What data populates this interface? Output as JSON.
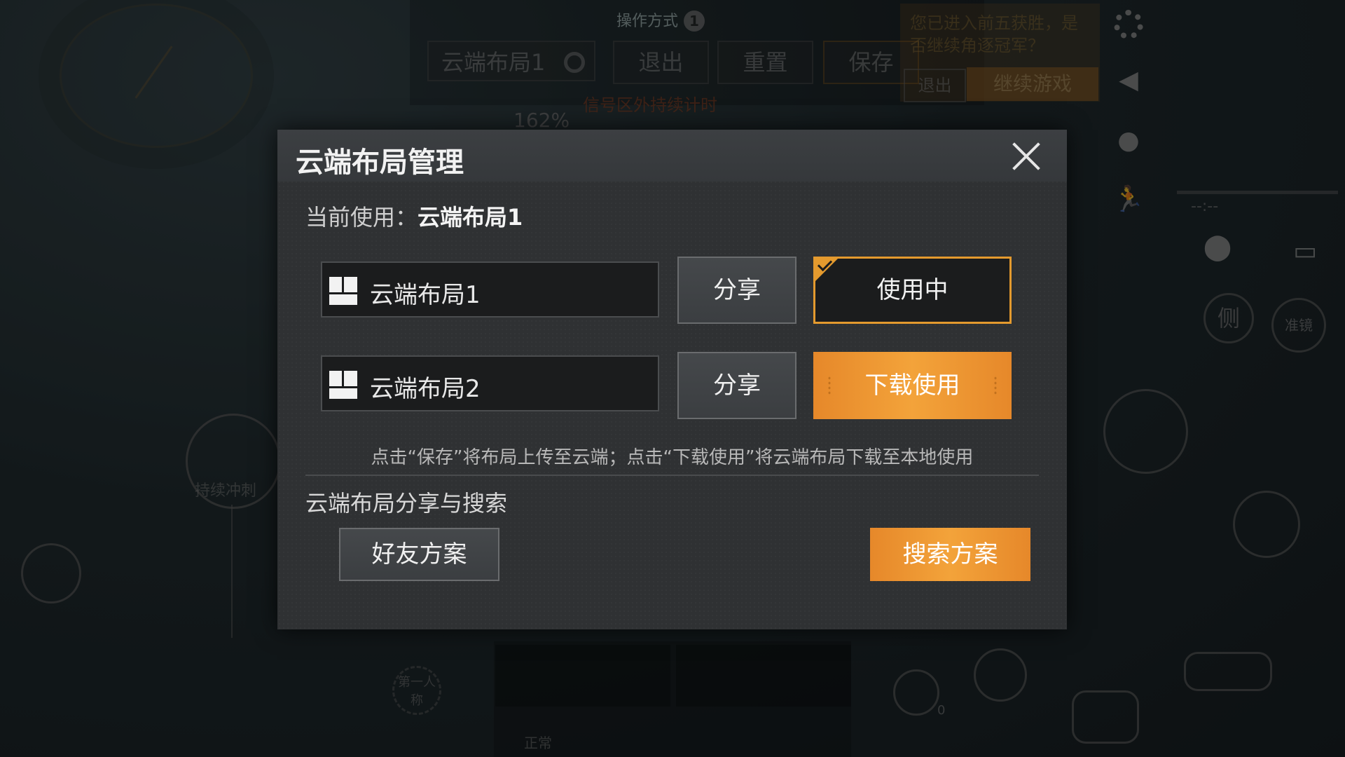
{
  "hud": {
    "op_mode": "操作方式",
    "op_mode_num": "1",
    "layout_btn": "云端布局1",
    "exit_btn": "退出",
    "reset_btn": "重置",
    "save_btn": "保存",
    "signal_text": "信号区外持续计时",
    "zoom_text": "162%",
    "notice_text": "您已进入前五获胜，是否继续角逐冠军？",
    "notice_exit": "退出",
    "notice_continue": "继续游戏",
    "sprint_label": "持续冲刺",
    "side_label": "侧",
    "scope_label": "准镜",
    "first_person": "第一人称",
    "normal_label": "正常",
    "grenade_count": "0",
    "timer": "--:--"
  },
  "modal": {
    "title": "云端布局管理",
    "current_label": "当前使用：",
    "current_value": "云端布局1",
    "layouts": [
      {
        "name": "云端布局1",
        "share": "分享",
        "action": "使用中",
        "state": "active"
      },
      {
        "name": "云端布局2",
        "share": "分享",
        "action": "下载使用",
        "state": "download"
      }
    ],
    "hint": "点击“保存”将布局上传至云端；点击“下载使用”将云端布局下载至本地使用",
    "section_title": "云端布局分享与搜索",
    "friend_btn": "好友方案",
    "search_btn": "搜索方案"
  },
  "colors": {
    "accent": "#e49a2e",
    "panel": "#2f3133",
    "field": "#1b1c1d"
  },
  "icons": [
    "close-icon",
    "layout-grid-icon",
    "check-icon",
    "gear-icon"
  ]
}
